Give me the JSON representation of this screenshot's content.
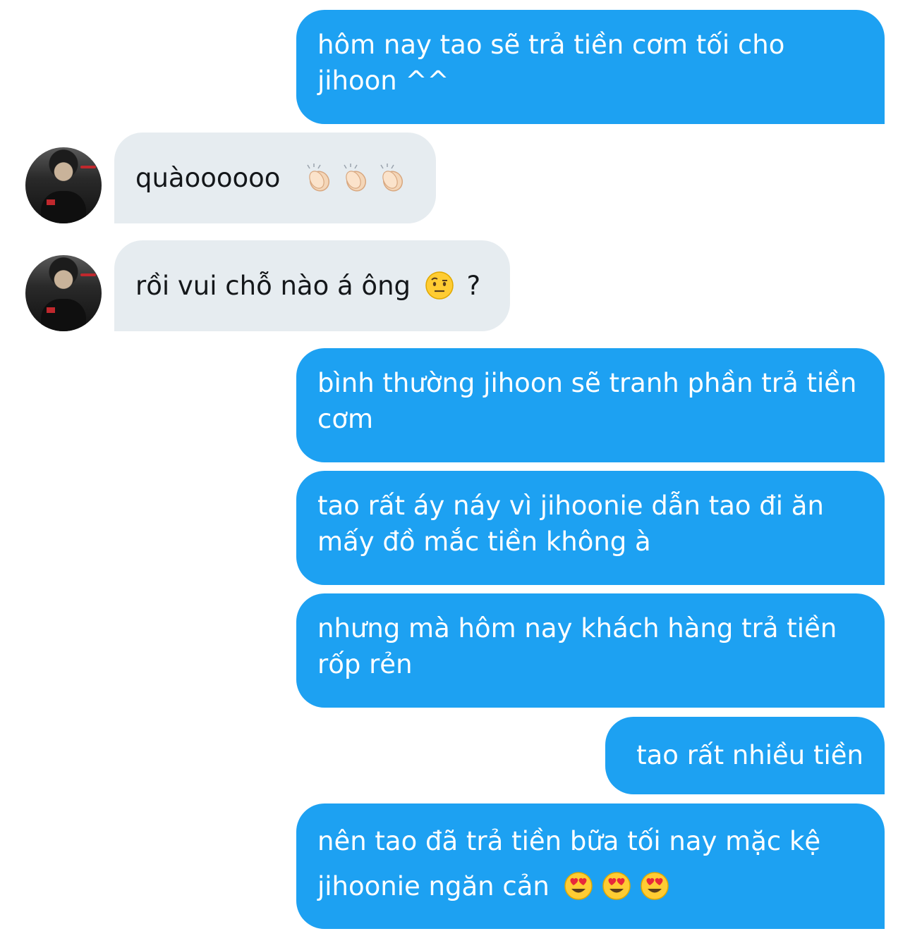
{
  "messages": [
    {
      "sender": "me",
      "text": "hôm nay tao sẽ trả tiền cơm tối cho jihoon ^^"
    },
    {
      "sender": "them",
      "text": "quàoooooo",
      "emojis": [
        "clapping-hands",
        "clapping-hands",
        "clapping-hands"
      ]
    },
    {
      "sender": "them",
      "text_before": "rồi vui chỗ nào á ông",
      "emoji": "face-with-raised-eyebrow",
      "text_after": "?"
    },
    {
      "sender": "me",
      "text": "bình thường jihoon sẽ tranh phần trả tiền cơm"
    },
    {
      "sender": "me",
      "text": "tao rất áy náy vì jihoonie dẫn tao đi ăn mấy đồ mắc tiền không à"
    },
    {
      "sender": "me",
      "text": "nhưng mà hôm nay khách hàng trả tiền rốp rẻn"
    },
    {
      "sender": "me",
      "text": "tao rất nhiều tiền"
    },
    {
      "sender": "me",
      "text": "nên tao đã trả tiền bữa tối nay mặc kệ jihoonie ngăn cản",
      "emojis": [
        "smiling-face-with-heart-eyes",
        "smiling-face-with-heart-eyes",
        "smiling-face-with-heart-eyes"
      ]
    }
  ],
  "colors": {
    "sent_bubble": "#1da1f2",
    "received_bubble": "#e6ecf0",
    "sent_text": "#ffffff",
    "received_text": "#14171a"
  }
}
